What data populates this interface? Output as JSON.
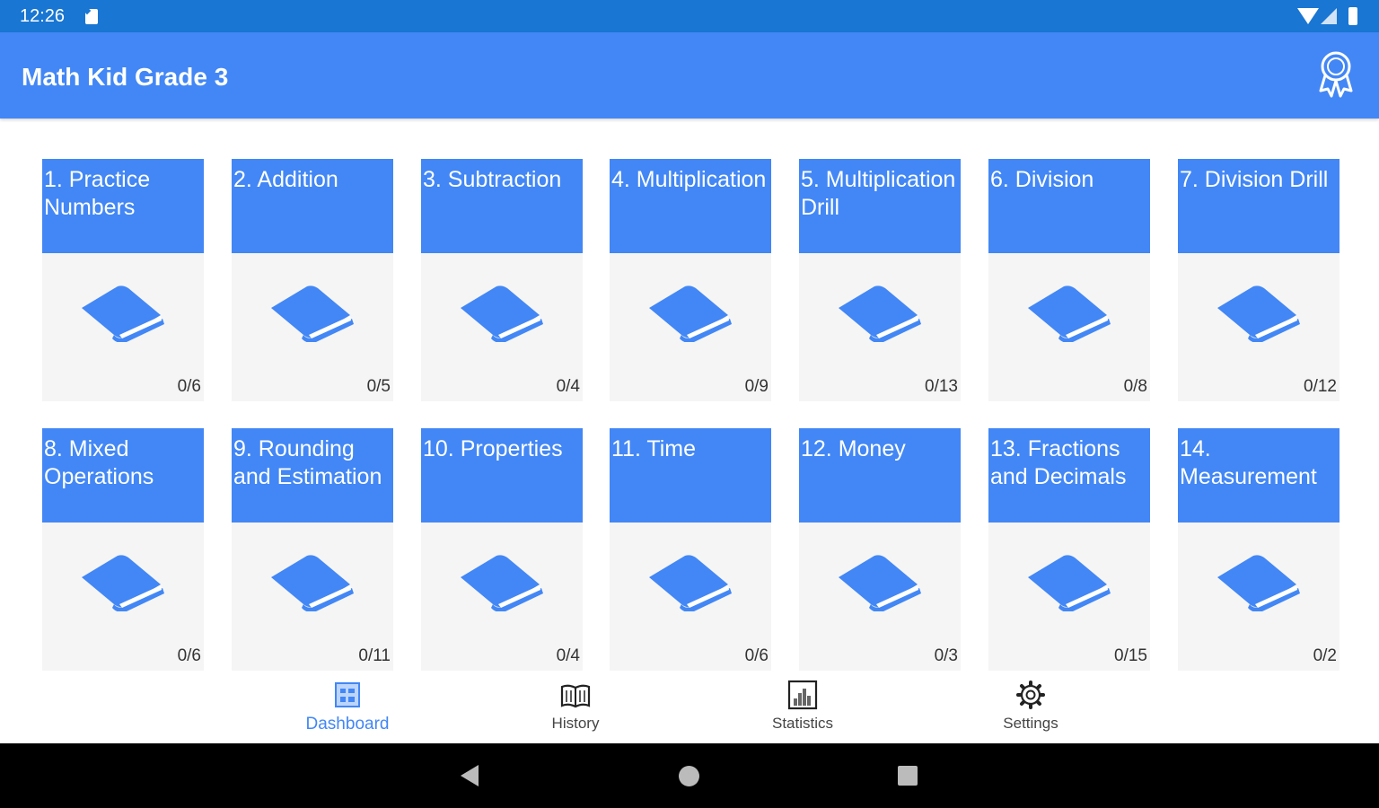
{
  "status_bar": {
    "time": "12:26"
  },
  "app_bar": {
    "title": "Math Kid Grade 3",
    "action_icon": "award-icon"
  },
  "colors": {
    "primary": "#4287f5",
    "status": "#1976d2",
    "card_bg": "#f5f5f5"
  },
  "topics": [
    {
      "label": "1. Practice Numbers",
      "progress": "0/6"
    },
    {
      "label": "2. Addition",
      "progress": "0/5"
    },
    {
      "label": "3. Subtraction",
      "progress": "0/4"
    },
    {
      "label": "4. Multiplication",
      "progress": "0/9"
    },
    {
      "label": "5. Multiplication Drill",
      "progress": "0/13"
    },
    {
      "label": "6. Division",
      "progress": "0/8"
    },
    {
      "label": "7. Division Drill",
      "progress": "0/12"
    },
    {
      "label": "8. Mixed Operations",
      "progress": "0/6"
    },
    {
      "label": "9. Rounding and Estimation",
      "progress": "0/11"
    },
    {
      "label": "10. Properties",
      "progress": "0/4"
    },
    {
      "label": "11. Time",
      "progress": "0/6"
    },
    {
      "label": "12. Money",
      "progress": "0/3"
    },
    {
      "label": "13. Fractions and Decimals",
      "progress": "0/15"
    },
    {
      "label": "14. Measurement",
      "progress": "0/2"
    }
  ],
  "bottom_nav": [
    {
      "label": "Dashboard",
      "icon": "dashboard-icon",
      "active": true
    },
    {
      "label": "History",
      "icon": "history-icon",
      "active": false
    },
    {
      "label": "Statistics",
      "icon": "statistics-icon",
      "active": false
    },
    {
      "label": "Settings",
      "icon": "settings-icon",
      "active": false
    }
  ]
}
